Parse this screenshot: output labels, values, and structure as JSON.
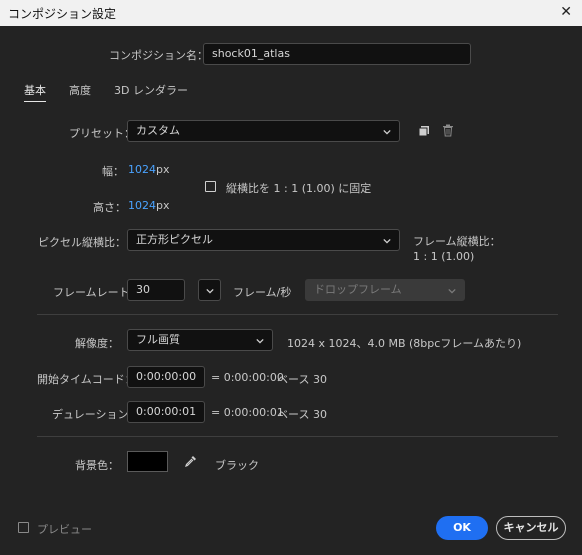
{
  "window": {
    "title": "コンポジション設定",
    "close_glyph": "✕"
  },
  "comp_name": {
    "label": "コンポジション名：",
    "value": "shock01_atlas"
  },
  "tabs": [
    {
      "label": "基本"
    },
    {
      "label": "高度"
    },
    {
      "label": "3D レンダラー"
    }
  ],
  "preset": {
    "label": "プリセット：",
    "value": "カスタム"
  },
  "width": {
    "label": "幅：",
    "value": "1024",
    "unit": "px"
  },
  "lock_aspect": {
    "label": "縦横比を 1 : 1 (1.00) に固定",
    "checked": false
  },
  "height": {
    "label": "高さ：",
    "value": "1024",
    "unit": "px"
  },
  "pixel_aspect": {
    "label": "ピクセル縦横比：",
    "value": "正方形ピクセル"
  },
  "frame_aspect": {
    "label": "フレーム縦横比：",
    "value": "1 : 1 (1.00)"
  },
  "frame_rate": {
    "label": "フレームレート：",
    "value": "30",
    "unit": "フレーム/秒",
    "drop_frame": "ドロップフレーム"
  },
  "resolution": {
    "label": "解像度：",
    "value": "フル画質",
    "info": "1024 x 1024、4.0 MB (8bpcフレームあたり)"
  },
  "start_timecode": {
    "label": "開始タイムコード：",
    "value": "0:00:00:00",
    "equals": "= 0:00:00:00",
    "base": "ベース 30"
  },
  "duration": {
    "label": "デュレーション：",
    "value": "0:00:00:01",
    "equals": "= 0:00:00:01",
    "base": "ベース 30"
  },
  "background": {
    "label": "背景色：",
    "color": "#000000",
    "name": "ブラック"
  },
  "footer": {
    "preview_label": "プレビュー",
    "ok": "OK",
    "cancel": "キャンセル"
  },
  "colors": {
    "accent": "#1f6ff2",
    "value_blue": "#4aa3ff"
  }
}
